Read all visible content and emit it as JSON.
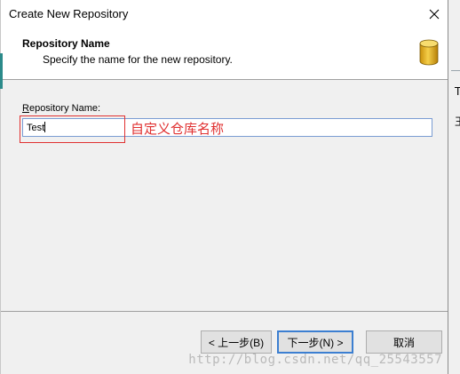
{
  "window": {
    "title": "Create New Repository"
  },
  "header": {
    "title": "Repository Name",
    "subtitle": "Specify the name for the new repository."
  },
  "form": {
    "label_underlined_char": "R",
    "label_rest": "epository Name:",
    "value": "Test"
  },
  "annotation": "自定义仓库名称",
  "buttons": {
    "back": "< 上一步(B)",
    "next": "下一步(N) >",
    "cancel": "取消"
  },
  "background_window": {
    "glyph_top": "T",
    "glyph_mid": "王"
  },
  "watermark": "http://blog.csdn.net/qq_25543557",
  "colors": {
    "annotation": "#e03030",
    "focus_border": "#3c7fd1",
    "input_border": "#7a9cd3",
    "db_icon": "#e8b824"
  }
}
